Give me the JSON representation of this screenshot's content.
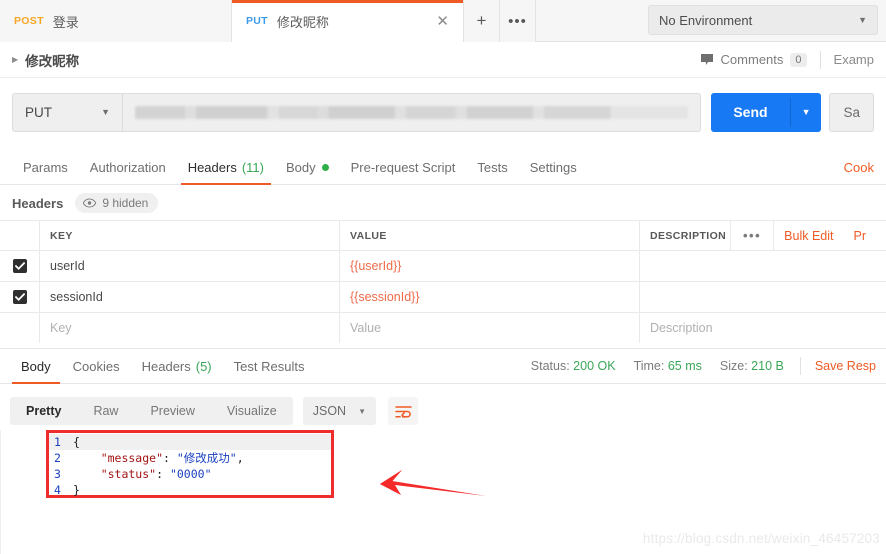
{
  "tabbar": {
    "tabs": [
      {
        "method": "POST",
        "name": "登录",
        "active": false
      },
      {
        "method": "PUT",
        "name": "修改昵称",
        "active": true
      }
    ],
    "close_glyph": "✕",
    "new_tab_glyph": "+",
    "more_glyph": "•••",
    "environment": {
      "label": "No Environment",
      "caret": "▼"
    }
  },
  "breadcrumb": {
    "arrow": "▶",
    "title": "修改昵称",
    "comments_label": "Comments",
    "comments_count": "0",
    "examples_label": "Examp"
  },
  "request": {
    "method": "PUT",
    "method_caret": "▼",
    "url_value": "",
    "send_label": "Send",
    "send_caret": "▼",
    "save_label": "Sa"
  },
  "request_tabs": {
    "items": [
      {
        "label": "Params",
        "count": "",
        "dot": false,
        "active": false
      },
      {
        "label": "Authorization",
        "count": "",
        "dot": false,
        "active": false
      },
      {
        "label": "Headers",
        "count": "(11)",
        "dot": false,
        "active": true
      },
      {
        "label": "Body",
        "count": "",
        "dot": true,
        "active": false
      },
      {
        "label": "Pre-request Script",
        "count": "",
        "dot": false,
        "active": false
      },
      {
        "label": "Tests",
        "count": "",
        "dot": false,
        "active": false
      },
      {
        "label": "Settings",
        "count": "",
        "dot": false,
        "active": false
      }
    ],
    "cookies_link": "Cook"
  },
  "headers_section": {
    "label": "Headers",
    "hidden_badge": "9 hidden",
    "columns": {
      "key": "KEY",
      "value": "VALUE",
      "description": "DESCRIPTION"
    },
    "actions": {
      "dots": "•••",
      "bulk_edit": "Bulk Edit",
      "presets": "Pr"
    },
    "rows": [
      {
        "checked": true,
        "key": "userId",
        "value": "{{userId}}",
        "description": ""
      },
      {
        "checked": true,
        "key": "sessionId",
        "value": "{{sessionId}}",
        "description": ""
      }
    ],
    "new_row": {
      "key_placeholder": "Key",
      "value_placeholder": "Value",
      "description_placeholder": "Description"
    }
  },
  "response_tabs": {
    "items": [
      {
        "label": "Body",
        "count": "",
        "active": true
      },
      {
        "label": "Cookies",
        "count": "",
        "active": false
      },
      {
        "label": "Headers",
        "count": "(5)",
        "active": false
      },
      {
        "label": "Test Results",
        "count": "",
        "active": false
      }
    ],
    "meta": {
      "status_label": "Status:",
      "status_value": "200 OK",
      "time_label": "Time:",
      "time_value": "65 ms",
      "size_label": "Size:",
      "size_value": "210 B",
      "save_response": "Save Resp"
    }
  },
  "view_toolbar": {
    "modes": [
      {
        "label": "Pretty",
        "active": true
      },
      {
        "label": "Raw",
        "active": false
      },
      {
        "label": "Preview",
        "active": false
      },
      {
        "label": "Visualize",
        "active": false
      }
    ],
    "format": "JSON",
    "format_caret": "▼",
    "wrap_icon": "word-wrap-icon"
  },
  "response_body": {
    "lines": [
      {
        "num": "1",
        "text": "{"
      },
      {
        "num": "2",
        "text": "    \"message\": \"修改成功\","
      },
      {
        "num": "3",
        "text": "    \"status\": \"0000\""
      },
      {
        "num": "4",
        "text": "}"
      }
    ],
    "json": {
      "message": "修改成功",
      "status": "0000"
    }
  },
  "annotations": {
    "highlight_color": "#ee2d2d",
    "arrow_color": "#f42a2a"
  },
  "watermark": "https://blog.csdn.net/weixin_46457203",
  "colors": {
    "accent_orange": "#ef5b25",
    "send_blue": "#1779f3",
    "success_green": "#3aa757",
    "post_orange": "#f5a623",
    "put_blue": "#3d9ae8"
  }
}
